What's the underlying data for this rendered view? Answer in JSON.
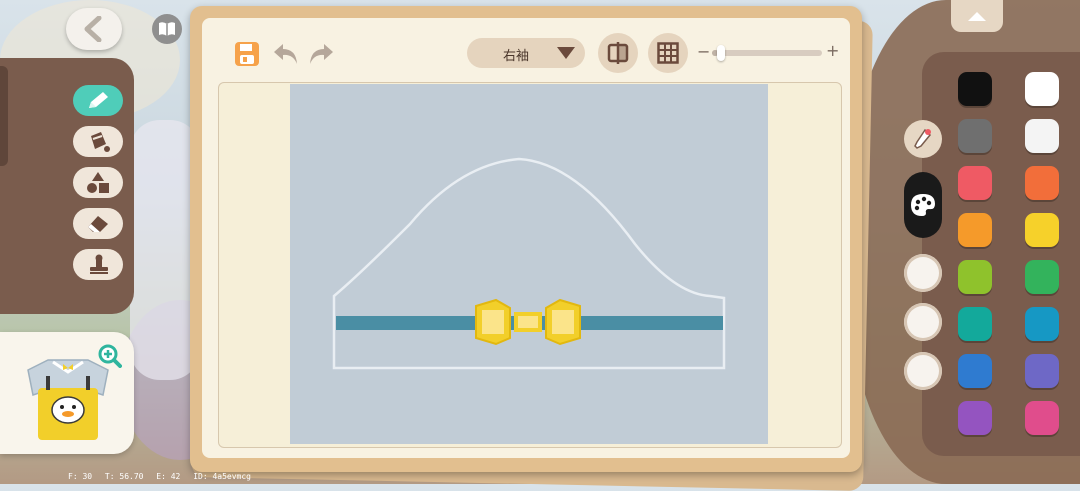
{
  "toolbar": {
    "part_label": "右袖",
    "zoom_value": 0.05
  },
  "tools": [
    "pencil",
    "fill",
    "shapes",
    "eraser",
    "stamp"
  ],
  "palette": {
    "left": [
      "#111111",
      "#6f6f6f",
      "#ef5a64",
      "#f59a2a",
      "#8fc22c",
      "#13a99b",
      "#2f7bd0",
      "#9454c0"
    ],
    "right": [
      "#ffffff",
      "#f4f4f4",
      "#f26e3a",
      "#f6d12a",
      "#33b35c",
      "#1698c4",
      "#6e68c6",
      "#e04d8c"
    ]
  },
  "debug": {
    "f": "F: 30",
    "t": "T: 56.70",
    "e": "E: 42",
    "id": "ID: 4a5evmcg"
  }
}
